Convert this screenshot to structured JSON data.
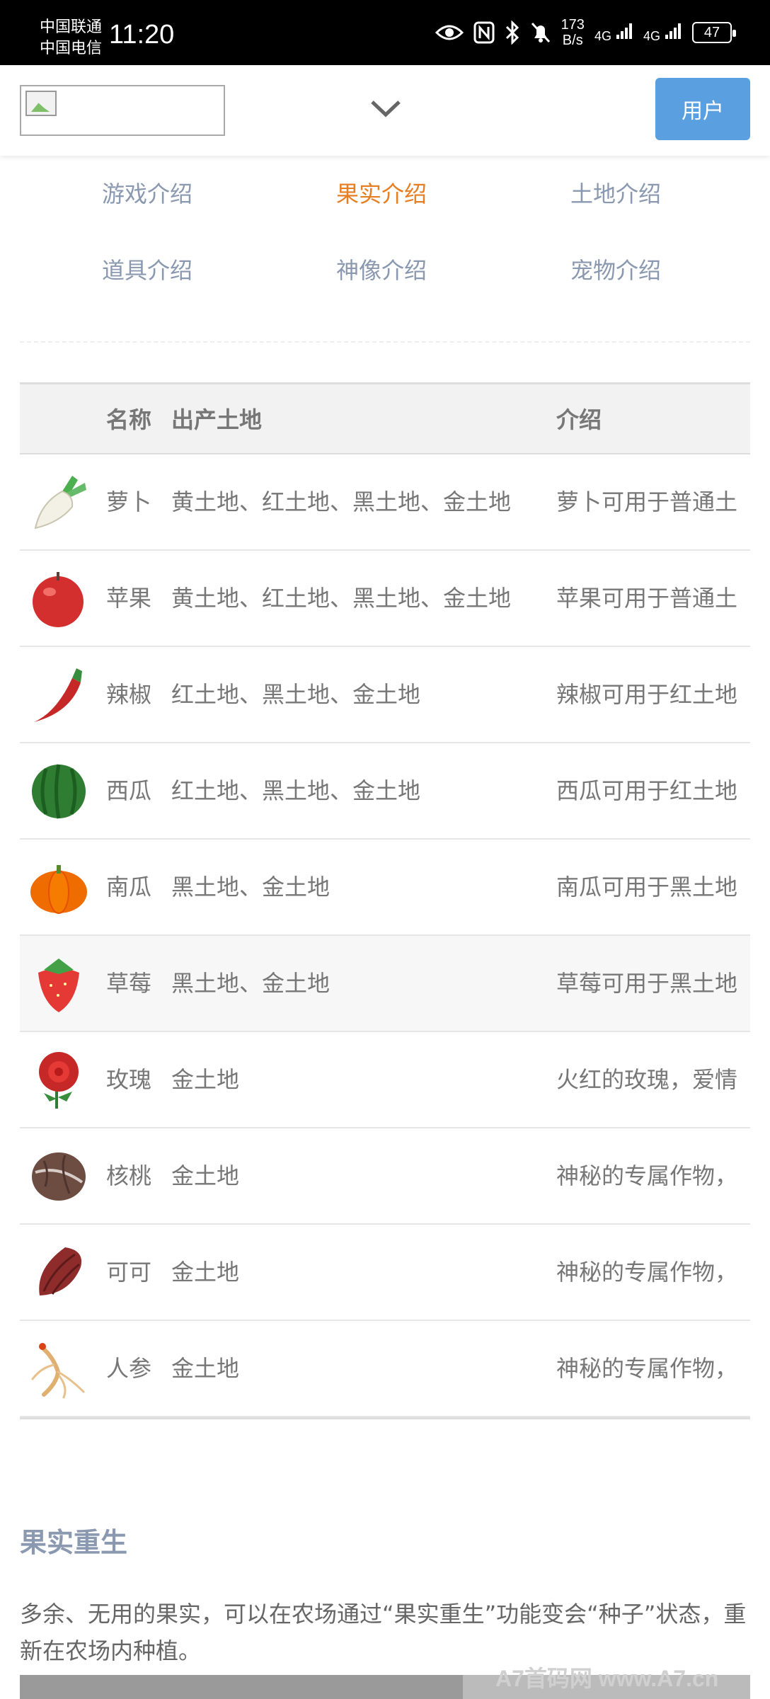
{
  "status_bar": {
    "carrier1": "中国联通",
    "carrier2": "中国电信",
    "time": "11:20",
    "net_speed_value": "173",
    "net_speed_unit": "B/s",
    "signal1": "4G",
    "signal2": "4G",
    "battery": "47"
  },
  "header": {
    "user_button": "用户"
  },
  "nav": {
    "items": [
      {
        "label": "游戏介绍",
        "active": false
      },
      {
        "label": "果实介绍",
        "active": true
      },
      {
        "label": "土地介绍",
        "active": false
      },
      {
        "label": "道具介绍",
        "active": false
      },
      {
        "label": "神像介绍",
        "active": false
      },
      {
        "label": "宠物介绍",
        "active": false
      }
    ],
    "active_color": "#e67e22",
    "color": "#8a98b0"
  },
  "table": {
    "headers": {
      "name": "名称",
      "land": "出产土地",
      "desc": "介绍"
    },
    "rows": [
      {
        "icon": "radish-icon",
        "name": "萝卜",
        "land": "黄土地、红土地、黑土地、金土地",
        "desc": "萝卜可用于普通土"
      },
      {
        "icon": "apple-icon",
        "name": "苹果",
        "land": "黄土地、红土地、黑土地、金土地",
        "desc": "苹果可用于普通土"
      },
      {
        "icon": "chili-icon",
        "name": "辣椒",
        "land": "红土地、黑土地、金土地",
        "desc": "辣椒可用于红土地"
      },
      {
        "icon": "watermelon-icon",
        "name": "西瓜",
        "land": "红土地、黑土地、金土地",
        "desc": "西瓜可用于红土地"
      },
      {
        "icon": "pumpkin-icon",
        "name": "南瓜",
        "land": "黑土地、金土地",
        "desc": "南瓜可用于黑土地"
      },
      {
        "icon": "strawberry-icon",
        "name": "草莓",
        "land": "黑土地、金土地",
        "desc": "草莓可用于黑土地"
      },
      {
        "icon": "rose-icon",
        "name": "玫瑰",
        "land": "金土地",
        "desc": "火红的玫瑰，爱情"
      },
      {
        "icon": "walnut-icon",
        "name": "核桃",
        "land": "金土地",
        "desc": "神秘的专属作物，"
      },
      {
        "icon": "cocoa-icon",
        "name": "可可",
        "land": "金土地",
        "desc": "神秘的专属作物，"
      },
      {
        "icon": "ginseng-icon",
        "name": "人参",
        "land": "金土地",
        "desc": "神秘的专属作物，"
      }
    ]
  },
  "section": {
    "title": "果实重生",
    "text": "多余、无用的果实，可以在农场通过“果实重生”功能变会“种子”状态，重新在农场内种植。"
  },
  "watermark": "A7首码网 www.A7.cn"
}
